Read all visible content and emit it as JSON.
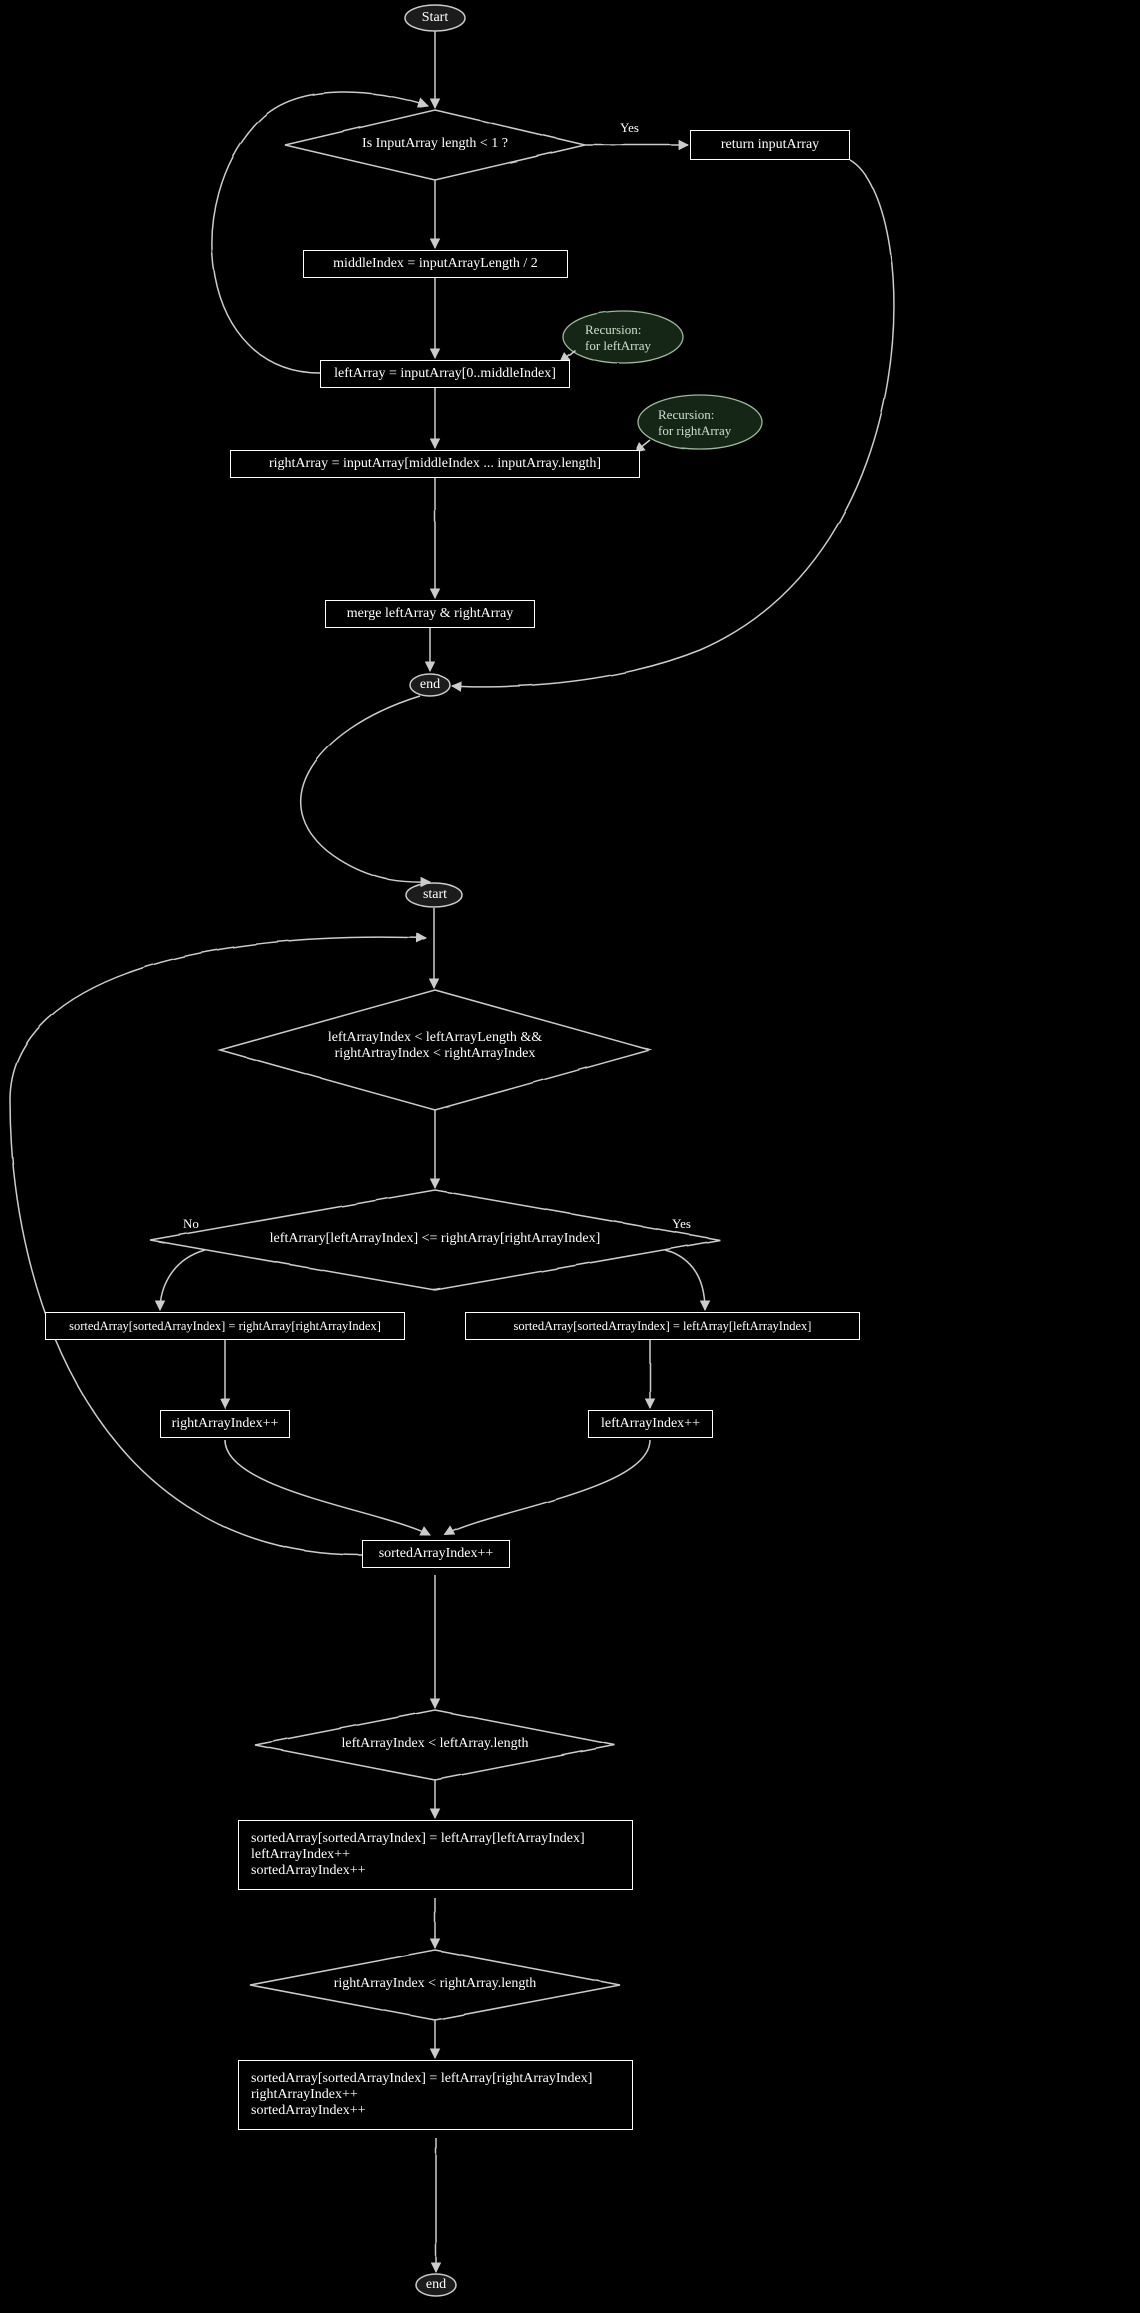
{
  "chart_data": {
    "type": "flowchart",
    "nodes": [
      {
        "id": "start1",
        "type": "terminal",
        "label": "Start"
      },
      {
        "id": "d1",
        "type": "decision",
        "label": "Is InputArray length < 1 ?"
      },
      {
        "id": "p_return",
        "type": "process",
        "label": "return inputArray"
      },
      {
        "id": "p_mid",
        "type": "process",
        "label": "middleIndex = inputArrayLength / 2"
      },
      {
        "id": "p_left",
        "type": "process",
        "label": "leftArray = inputArray[0..middleIndex]"
      },
      {
        "id": "p_right",
        "type": "process",
        "label": "rightArray = inputArray[middleIndex ... inputArray.length]"
      },
      {
        "id": "p_merge",
        "type": "process",
        "label": "merge leftArray & rightArray"
      },
      {
        "id": "end1",
        "type": "terminal",
        "label": "end"
      },
      {
        "id": "ann_left",
        "type": "annotation",
        "label": "Recursion:\nfor leftArray"
      },
      {
        "id": "ann_right",
        "type": "annotation",
        "label": "Recursion:\nfor rightArray"
      },
      {
        "id": "start2",
        "type": "terminal",
        "label": "start"
      },
      {
        "id": "d2",
        "type": "decision",
        "label": "leftArrayIndex < leftArrayLength &&\nrightArtrayIndex < rightArrayIndex"
      },
      {
        "id": "d3",
        "type": "decision",
        "label": "leftArrary[leftArrayIndex] <= rightArray[rightArrayIndex]"
      },
      {
        "id": "p_sr",
        "type": "process",
        "label": "sortedArray[sortedArrayIndex] = rightArray[rightArrayIndex]"
      },
      {
        "id": "p_sl",
        "type": "process",
        "label": "sortedArray[sortedArrayIndex] = leftArray[leftArrayIndex]"
      },
      {
        "id": "p_rinc",
        "type": "process",
        "label": "rightArrayIndex++"
      },
      {
        "id": "p_linc",
        "type": "process",
        "label": "leftArrayIndex++"
      },
      {
        "id": "p_sinc",
        "type": "process",
        "label": "sortedArrayIndex++"
      },
      {
        "id": "d4",
        "type": "decision",
        "label": "leftArrayIndex < leftArray.length"
      },
      {
        "id": "p_remL",
        "type": "process",
        "label": "sortedArray[sortedArrayIndex] = leftArray[leftArrayIndex]\nleftArrayIndex++\nsortedArrayIndex++"
      },
      {
        "id": "d5",
        "type": "decision",
        "label": "rightArrayIndex < rightArray.length"
      },
      {
        "id": "p_remR",
        "type": "process",
        "label": "sortedArray[sortedArrayIndex] = leftArray[rightArrayIndex]\nrightArrayIndex++\nsortedArrayIndex++"
      },
      {
        "id": "end2",
        "type": "terminal",
        "label": "end"
      }
    ],
    "edges": [
      {
        "from": "start1",
        "to": "d1"
      },
      {
        "from": "d1",
        "to": "p_return",
        "label": "Yes"
      },
      {
        "from": "d1",
        "to": "p_mid"
      },
      {
        "from": "p_mid",
        "to": "p_left"
      },
      {
        "from": "p_left",
        "to": "p_right"
      },
      {
        "from": "p_right",
        "to": "p_merge"
      },
      {
        "from": "p_merge",
        "to": "end1"
      },
      {
        "from": "p_return",
        "to": "end1"
      },
      {
        "from": "p_left",
        "to": "d1",
        "note": "recursion leftArray"
      },
      {
        "from": "p_right",
        "to": "d1",
        "note": "recursion rightArray (via annotation path offscreen)"
      },
      {
        "from": "end1",
        "to": "start2",
        "note": "merge subroutine"
      },
      {
        "from": "start2",
        "to": "d2"
      },
      {
        "from": "d2",
        "to": "d3"
      },
      {
        "from": "d3",
        "to": "p_sr",
        "label": "No"
      },
      {
        "from": "d3",
        "to": "p_sl",
        "label": "Yes"
      },
      {
        "from": "p_sr",
        "to": "p_rinc"
      },
      {
        "from": "p_sl",
        "to": "p_linc"
      },
      {
        "from": "p_rinc",
        "to": "p_sinc"
      },
      {
        "from": "p_linc",
        "to": "p_sinc"
      },
      {
        "from": "p_sinc",
        "to": "d2",
        "note": "loop back"
      },
      {
        "from": "p_sinc",
        "to": "d4"
      },
      {
        "from": "d4",
        "to": "p_remL"
      },
      {
        "from": "p_remL",
        "to": "d5"
      },
      {
        "from": "d5",
        "to": "p_remR"
      },
      {
        "from": "p_remR",
        "to": "end2"
      }
    ],
    "edge_labels": {
      "yes1": "Yes",
      "no3": "No",
      "yes3": "Yes"
    }
  },
  "labels": {
    "start1": "Start",
    "d1": "Is InputArray length < 1 ?",
    "p_return": "return inputArray",
    "p_mid": "middleIndex = inputArrayLength / 2",
    "p_left": "leftArray = inputArray[0..middleIndex]",
    "p_right": "rightArray = inputArray[middleIndex ... inputArray.length]",
    "p_merge": "merge leftArray & rightArray",
    "end1": "end",
    "ann_left": "Recursion:\nfor leftArray",
    "ann_right": "Recursion:\nfor rightArray",
    "start2": "start",
    "d2": "leftArrayIndex < leftArrayLength &&\nrightArtrayIndex < rightArrayIndex",
    "d3": "leftArrary[leftArrayIndex] <= rightArray[rightArrayIndex]",
    "p_sr": "sortedArray[sortedArrayIndex] = rightArray[rightArrayIndex]",
    "p_sl": "sortedArray[sortedArrayIndex] = leftArray[leftArrayIndex]",
    "p_rinc": "rightArrayIndex++",
    "p_linc": "leftArrayIndex++",
    "p_sinc": "sortedArrayIndex++",
    "d4": "leftArrayIndex < leftArray.length",
    "p_remL": "sortedArray[sortedArrayIndex] = leftArray[leftArrayIndex]\nleftArrayIndex++\nsortedArrayIndex++",
    "d5": "rightArrayIndex < rightArray.length",
    "p_remR": "sortedArray[sortedArrayIndex] = leftArray[rightArrayIndex]\nrightArrayIndex++\nsortedArrayIndex++",
    "end2": "end",
    "yes1": "Yes",
    "no3": "No",
    "yes3": "Yes"
  }
}
